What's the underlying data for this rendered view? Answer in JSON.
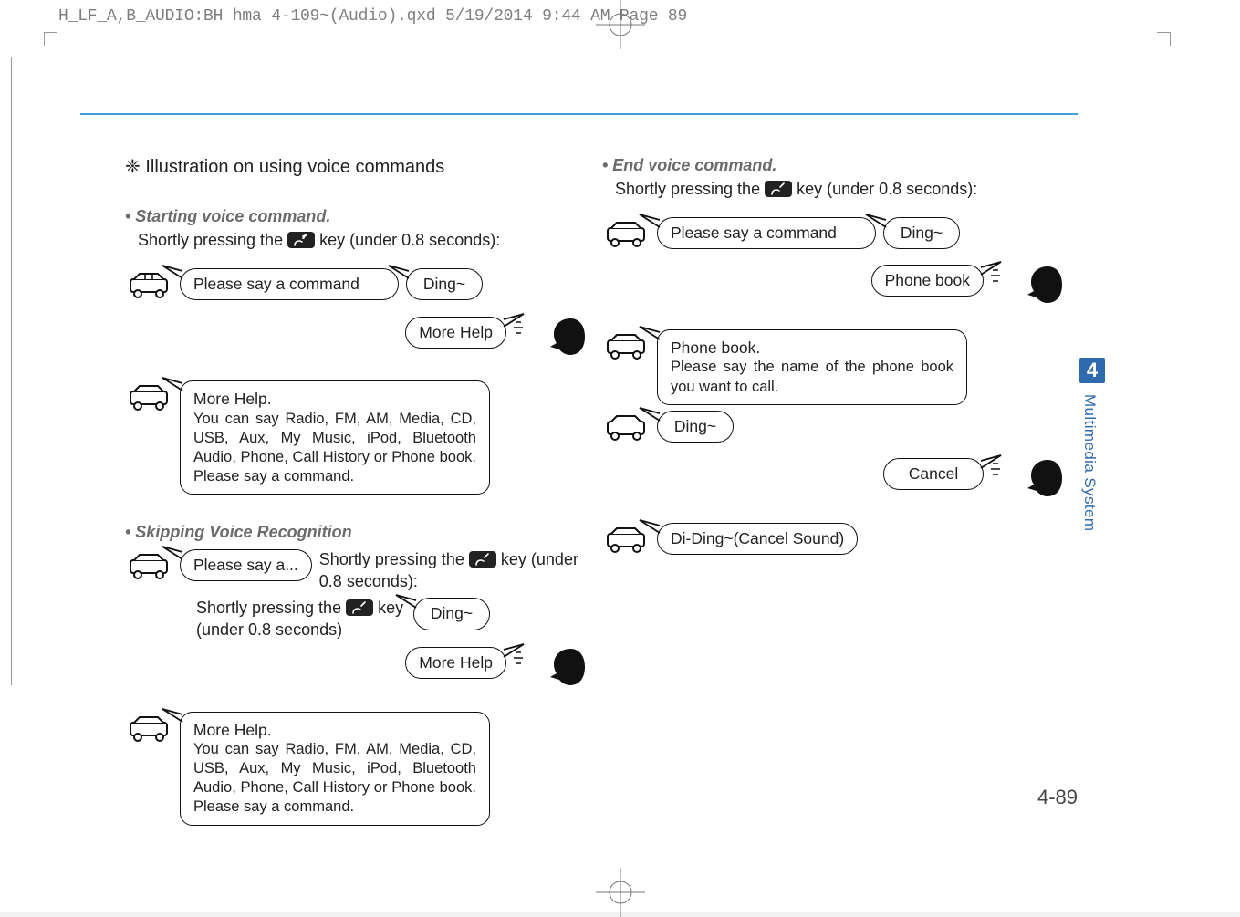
{
  "crop": "H_LF_A,B_AUDIO:BH hma 4-109~(Audio).qxd  5/19/2014  9:44 AM  Page 89",
  "page_number": "4-89",
  "tab_number": "4",
  "side_title": "Multimedia System",
  "left": {
    "intro": "❈ Illustration on using voice commands",
    "start": {
      "heading": "• Starting voice command.",
      "press_a": "Shortly pressing the ",
      "press_b": " key (under 0.8 seconds):",
      "say_cmd": "Please say a command",
      "ding": "Ding~",
      "more_help": "More Help",
      "mh_title": "More Help.",
      "mh_body": "You can say Radio, FM, AM, Media, CD, USB, Aux, My Music, iPod, Bluetooth Audio, Phone, Call History or Phone book. Please say a command."
    },
    "skip": {
      "heading": "• Skipping Voice Recognition",
      "say_a": "Please say a...",
      "press_a": "Shortly pressing the ",
      "press_b": " key (under 0.8 seconds):",
      "press2_a": "Shortly pressing the ",
      "press2_b": " key (under 0.8 seconds)",
      "ding": "Ding~",
      "more_help": "More Help",
      "mh_title": "More Help.",
      "mh_body": "You can say Radio, FM, AM, Media, CD, USB, Aux, My Music, iPod, Bluetooth Audio, Phone, Call History or Phone book. Please say a command."
    }
  },
  "right": {
    "end": {
      "heading": "• End voice command.",
      "press_a": "Shortly pressing the ",
      "press_b": " key (under 0.8 seconds):",
      "say_cmd": "Please say a command",
      "ding": "Ding~",
      "phonebook_btn": "Phone book",
      "pb_title": "Phone book.",
      "pb_body": "Please say the name of the phone book you want to call.",
      "ding2": "Ding~",
      "cancel": "Cancel",
      "cancel_sound": "Di-Ding~(Cancel Sound)"
    }
  }
}
